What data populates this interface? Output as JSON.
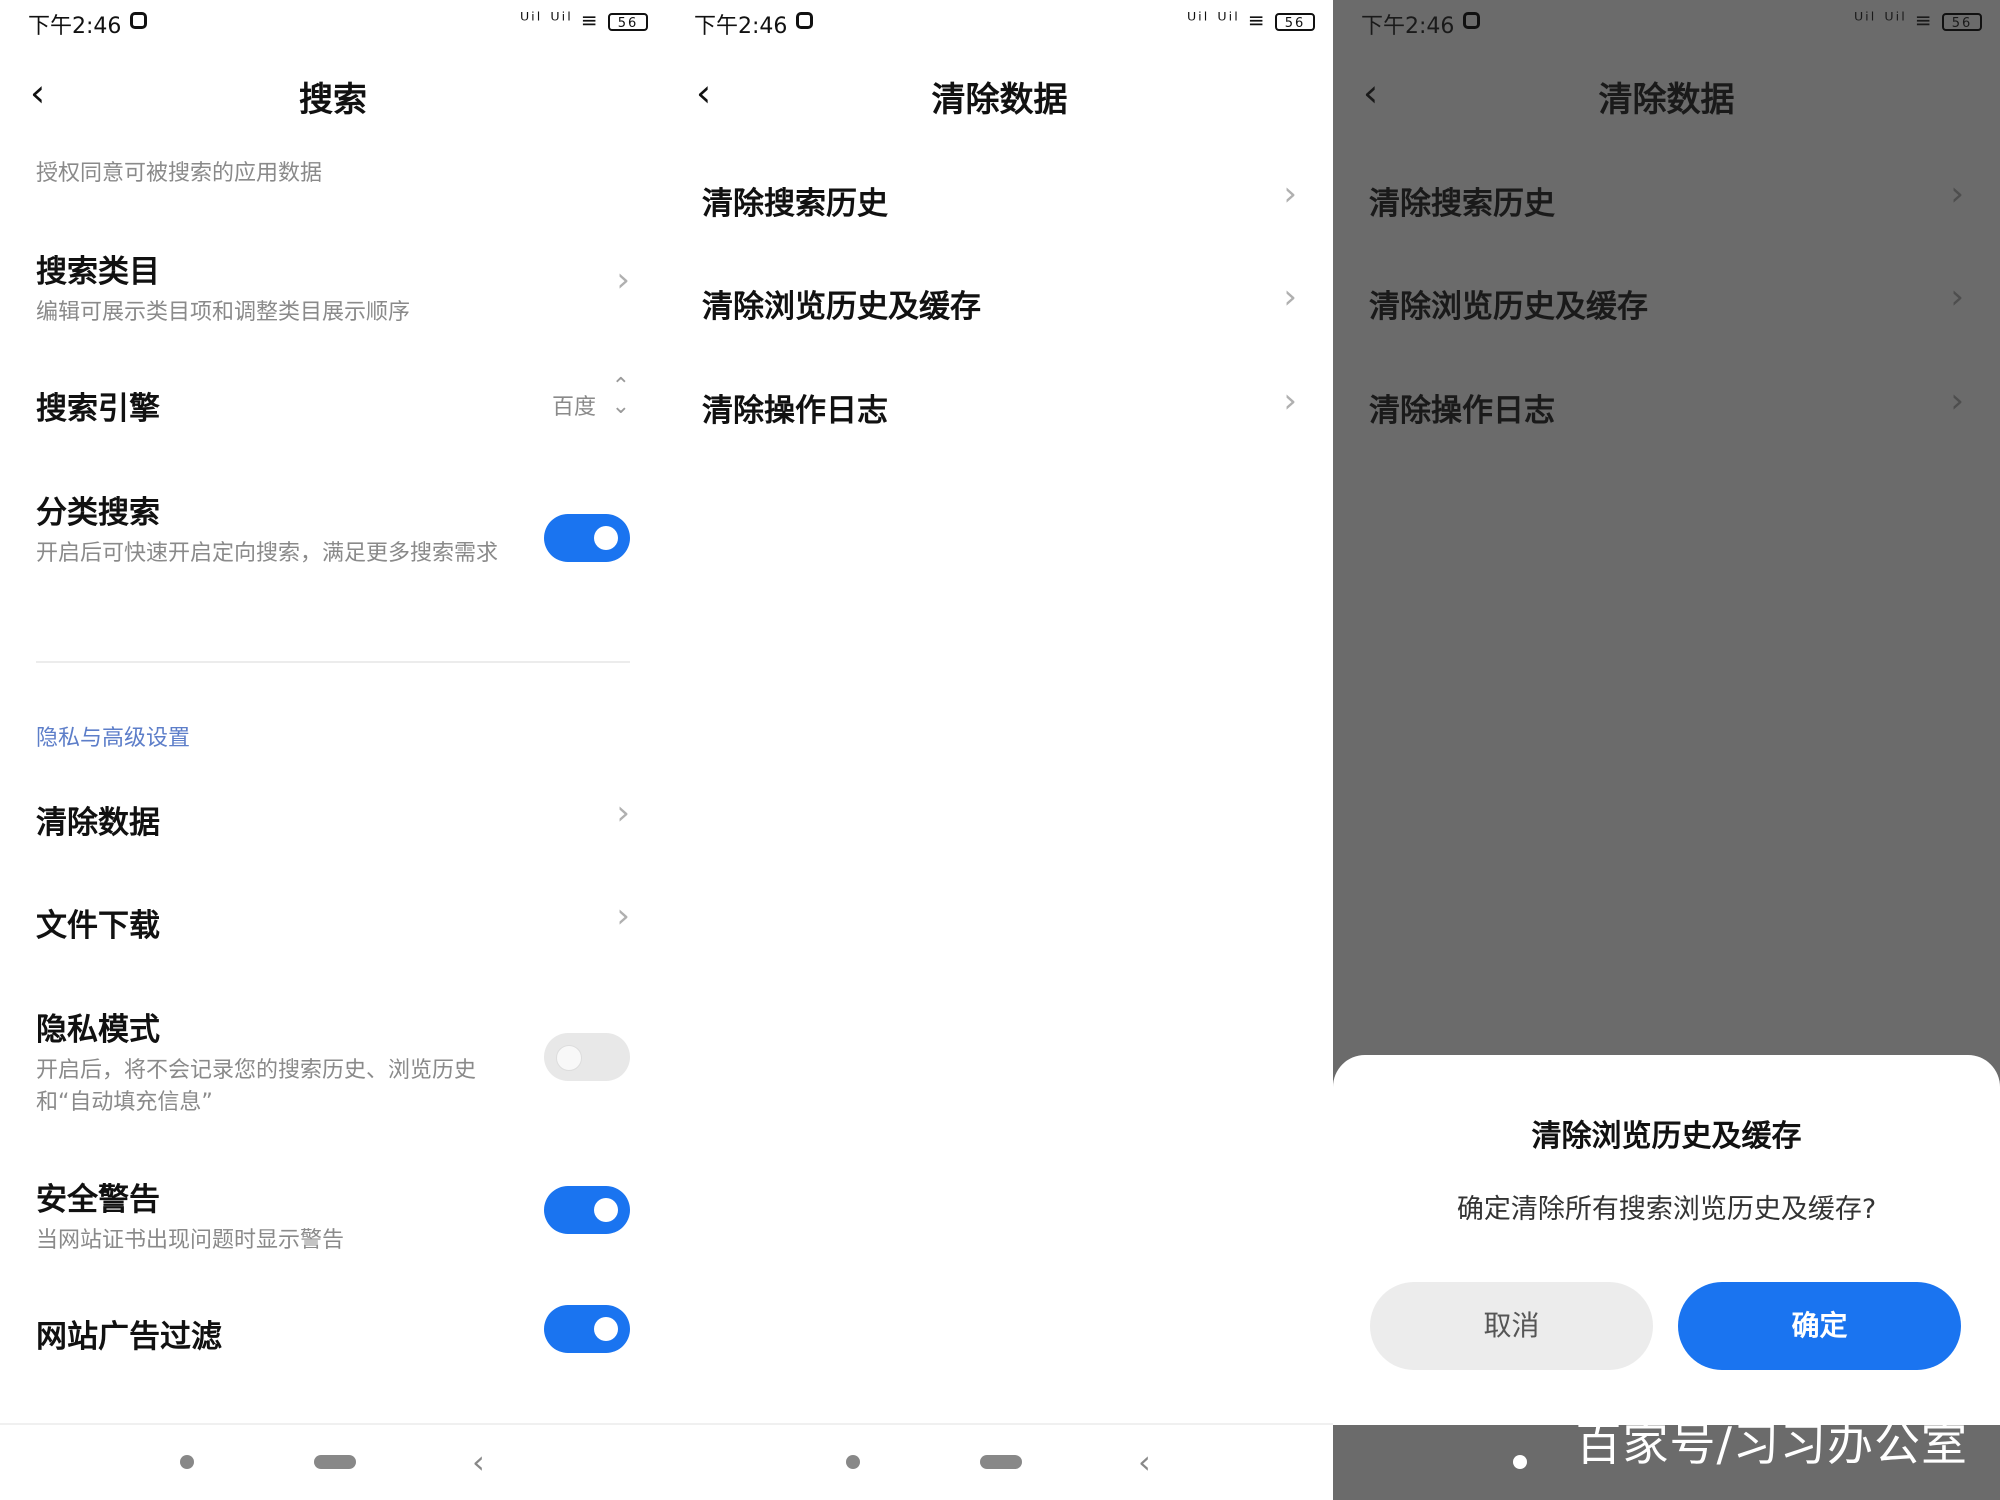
{
  "status_bar": {
    "time": "下午2:46",
    "signal": "ᵁⁱˡ ᵁⁱˡ ≡",
    "battery": "56"
  },
  "nav_icons": {
    "back_arrow": "‹",
    "chevron": "›",
    "updown": "⌃⌄"
  },
  "search_settings": {
    "title": "搜索",
    "truncated_desc": "授权同意可被搜索的应用数据",
    "items": [
      {
        "title": "搜索类目",
        "desc": "编辑可展示类目项和调整类目展示顺序"
      },
      {
        "title": "搜索引擎",
        "value": "百度"
      },
      {
        "title": "分类搜索",
        "desc": "开启后可快速开启定向搜索，满足更多搜索需求",
        "toggle": true
      }
    ],
    "section_label": "隐私与高级设置",
    "privacy_items": [
      {
        "title": "清除数据"
      },
      {
        "title": "文件下载"
      },
      {
        "title": "隐私模式",
        "desc": "开启后，将不会记录您的搜索历史、浏览历史和“自动填充信息”",
        "toggle": false
      },
      {
        "title": "安全警告",
        "desc": "当网站证书出现问题时显示警告",
        "toggle": true
      },
      {
        "title": "网站广告过滤",
        "toggle": true
      }
    ]
  },
  "clear_data": {
    "title": "清除数据",
    "items": [
      {
        "title": "清除搜索历史"
      },
      {
        "title": "清除浏览历史及缓存"
      },
      {
        "title": "清除操作日志"
      }
    ]
  },
  "dialog": {
    "title": "清除浏览历史及缓存",
    "message": "确定清除所有搜索浏览历史及缓存?",
    "cancel_label": "取消",
    "confirm_label": "确定"
  },
  "watermark": "百家号/习习办公室",
  "colors": {
    "accent": "#1a74f0",
    "section": "#5d7ec9",
    "overlay": "#6b6b6b"
  }
}
